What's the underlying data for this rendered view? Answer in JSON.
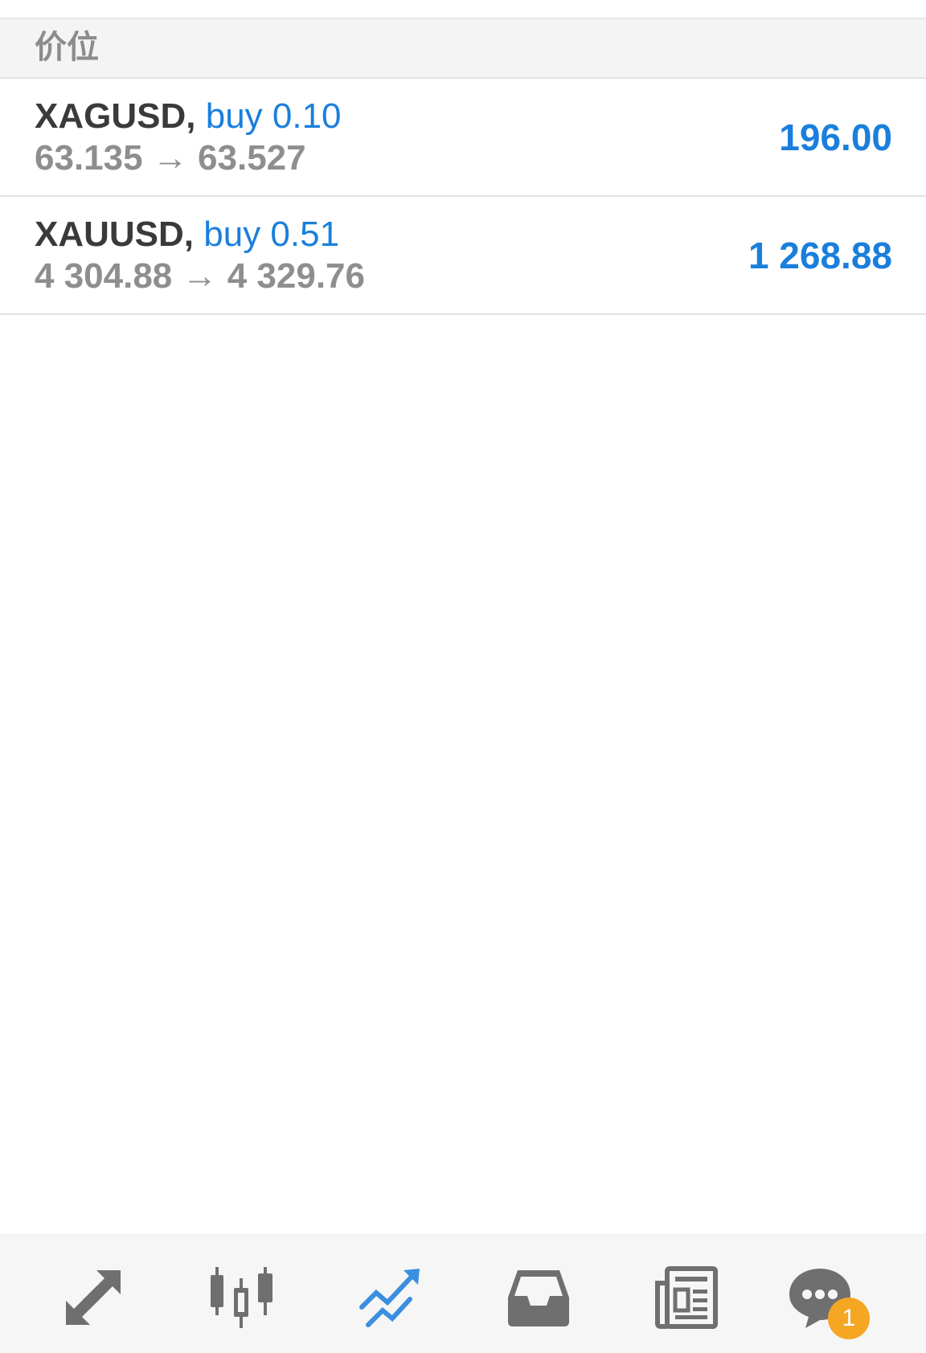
{
  "section": {
    "title": "价位"
  },
  "positions": [
    {
      "symbol": "XAGUSD,",
      "side": "buy 0.10",
      "prices": "63.135 → 63.527",
      "profit": "196.00"
    },
    {
      "symbol": "XAUUSD,",
      "side": "buy 0.51",
      "prices": "4 304.88 → 4 329.76",
      "profit": "1 268.88"
    }
  ],
  "bottom_nav": {
    "items": [
      {
        "icon": "quotes-arrows-icon"
      },
      {
        "icon": "candlestick-chart-icon"
      },
      {
        "icon": "trade-icon",
        "active": true
      },
      {
        "icon": "history-inbox-icon"
      },
      {
        "icon": "news-icon"
      },
      {
        "icon": "chat-icon"
      }
    ],
    "chat_badge": "1"
  },
  "colors": {
    "accent": "#1a7fdc",
    "symbol_text": "#3a3a3a",
    "muted_text": "#8e8e8e",
    "badge": "#f5a623",
    "icon_gray": "#6f6f6f"
  }
}
